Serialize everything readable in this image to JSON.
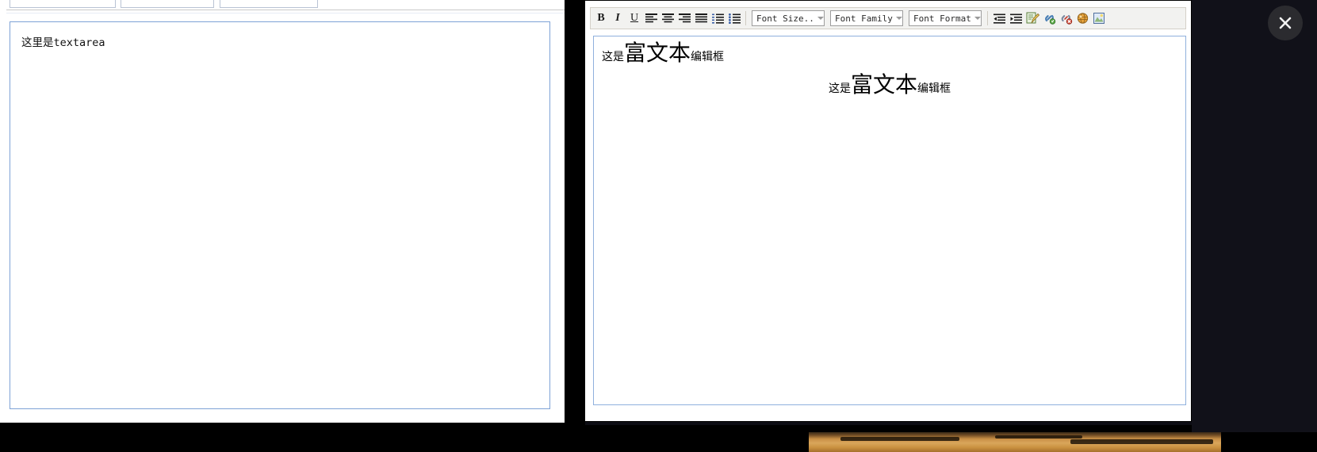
{
  "window": {
    "background_color": "#0d0d14",
    "divider_color": "#000000"
  },
  "left_panel": {
    "name": "plain-textarea-demo",
    "tabs": [
      {
        "label": ""
      },
      {
        "label": ""
      },
      {
        "label": ""
      }
    ],
    "textarea": {
      "value": "这里是textarea",
      "placeholder": "",
      "border_color": "#7ea2d6",
      "resize_grip": "resize-grip"
    }
  },
  "right_panel": {
    "name": "rich-text-editor",
    "toolbar": {
      "bold_label": "B",
      "italic_label": "I",
      "underline_label": "U",
      "buttons": [
        {
          "name": "bold-button",
          "label": "B",
          "icon": "bold-icon"
        },
        {
          "name": "italic-button",
          "label": "I",
          "icon": "italic-icon"
        },
        {
          "name": "underline-button",
          "label": "U",
          "icon": "underline-icon"
        },
        {
          "name": "align-left-button",
          "label": "",
          "icon": "align-left-icon"
        },
        {
          "name": "align-center-button",
          "label": "",
          "icon": "align-center-icon"
        },
        {
          "name": "align-right-button",
          "label": "",
          "icon": "align-right-icon"
        },
        {
          "name": "align-justify-button",
          "label": "",
          "icon": "align-justify-icon"
        },
        {
          "name": "ordered-list-button",
          "label": "",
          "icon": "ordered-list-icon"
        },
        {
          "name": "unordered-list-button",
          "label": "",
          "icon": "unordered-list-icon"
        },
        {
          "name": "outdent-button",
          "label": "",
          "icon": "outdent-icon"
        },
        {
          "name": "indent-button",
          "label": "",
          "icon": "indent-icon"
        },
        {
          "name": "edit-source-button",
          "label": "",
          "icon": "edit-page-icon"
        },
        {
          "name": "insert-link-button",
          "label": "",
          "icon": "link-icon"
        },
        {
          "name": "remove-link-button",
          "label": "",
          "icon": "unlink-icon"
        },
        {
          "name": "insert-anchor-button",
          "label": "",
          "icon": "anchor-globe-icon"
        },
        {
          "name": "insert-image-button",
          "label": "",
          "icon": "image-icon"
        }
      ],
      "selects": [
        {
          "name": "font-size-select",
          "value": "Font Size..",
          "caret": "chevron-down-icon"
        },
        {
          "name": "font-family-select",
          "value": "Font Family",
          "caret": "chevron-down-icon"
        },
        {
          "name": "font-format-select",
          "value": "Font Format",
          "caret": "chevron-down-icon"
        }
      ],
      "background_color": "#f2f2f0",
      "border_color": "#d4d0c8"
    },
    "content": {
      "border_color": "#8fb0dd",
      "lines": [
        {
          "align": "left",
          "prefix": "这是",
          "emphasis": "富文本",
          "suffix": "编辑框"
        },
        {
          "align": "center",
          "prefix": "这是",
          "emphasis": "富文本",
          "suffix": "编辑框"
        }
      ]
    }
  },
  "close_button": {
    "name": "close-button",
    "icon": "close-x-icon",
    "background_color": "#2b2b2f",
    "glyph_color": "#ffffff"
  },
  "bottom_strip": {
    "name": "background-photo-sliver",
    "description": ""
  }
}
